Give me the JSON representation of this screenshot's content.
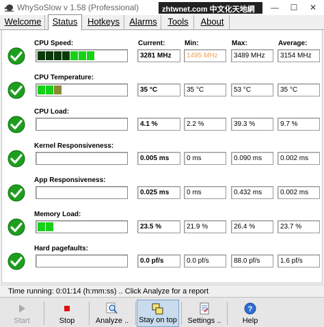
{
  "window": {
    "title": "WhySoSlow v 1.58 (Professional)",
    "watermark": "zhtwnet.com 中文化天地網",
    "minimize_glyph": "—",
    "maximize_glyph": "☐",
    "close_glyph": "✕"
  },
  "tabs": [
    {
      "label": "Welcome",
      "active": false
    },
    {
      "label": "Status",
      "active": true
    },
    {
      "label": "Hotkeys",
      "active": false
    },
    {
      "label": "Alarms",
      "active": false
    },
    {
      "label": "Tools",
      "active": false
    },
    {
      "label": "About",
      "active": false
    }
  ],
  "columns": {
    "current": "Current:",
    "min": "Min:",
    "max": "Max:",
    "average": "Average:"
  },
  "metrics": [
    {
      "label": "CPU Speed:",
      "current": "3281 MHz",
      "min": "1495 MHz",
      "max": "3489 MHz",
      "average": "3154 MHz",
      "level": 0.71,
      "style": "speed",
      "min_color": "#f0a050"
    },
    {
      "label": "CPU Temperature:",
      "current": "35 °C",
      "min": "35 °C",
      "max": "53 °C",
      "average": "35 °C",
      "level": 0.29,
      "style": "temp"
    },
    {
      "label": "CPU Load:",
      "current": "4.1 %",
      "min": "2.2 %",
      "max": "39.3 %",
      "average": "9.7 %",
      "level": 0.0,
      "style": "green"
    },
    {
      "label": "Kernel Responsiveness:",
      "current": "0.005 ms",
      "min": "0 ms",
      "max": "0.090 ms",
      "average": "0.002 ms",
      "level": 0.0,
      "style": "green"
    },
    {
      "label": "App Responsiveness:",
      "current": "0.025 ms",
      "min": "0 ms",
      "max": "0.432 ms",
      "average": "0.002 ms",
      "level": 0.0,
      "style": "green"
    },
    {
      "label": "Memory Load:",
      "current": "23.5 %",
      "min": "21.9 %",
      "max": "26.4 %",
      "average": "23.7 %",
      "level": 0.2,
      "style": "green"
    },
    {
      "label": "Hard pagefaults:",
      "current": "0.0 pf/s",
      "min": "0.0 pf/s",
      "max": "88.0 pf/s",
      "average": "1.6 pf/s",
      "level": 0.0,
      "style": "green"
    }
  ],
  "status": {
    "text": "Time running: 0:01:14  (h:mm:ss) ..  Click Analyze for a report"
  },
  "toolbar": [
    {
      "label": "Start",
      "icon": "play-icon",
      "state": "disabled"
    },
    {
      "label": "Stop",
      "icon": "stop-icon",
      "state": "normal"
    },
    {
      "label": "Analyze ..",
      "icon": "magnifier-icon",
      "state": "normal"
    },
    {
      "label": "Stay on top",
      "icon": "windows-stack-icon",
      "state": "pressed"
    },
    {
      "label": "Settings ..",
      "icon": "settings-document-icon",
      "state": "normal"
    },
    {
      "label": "Help",
      "icon": "help-icon",
      "state": "normal"
    }
  ],
  "colors": {
    "bar_green": "#18d018",
    "bar_dark_green": "#0a3a0a",
    "bar_olive": "#8a8a30",
    "check_green": "#1e9e1e",
    "stop_red": "#dd1111"
  }
}
